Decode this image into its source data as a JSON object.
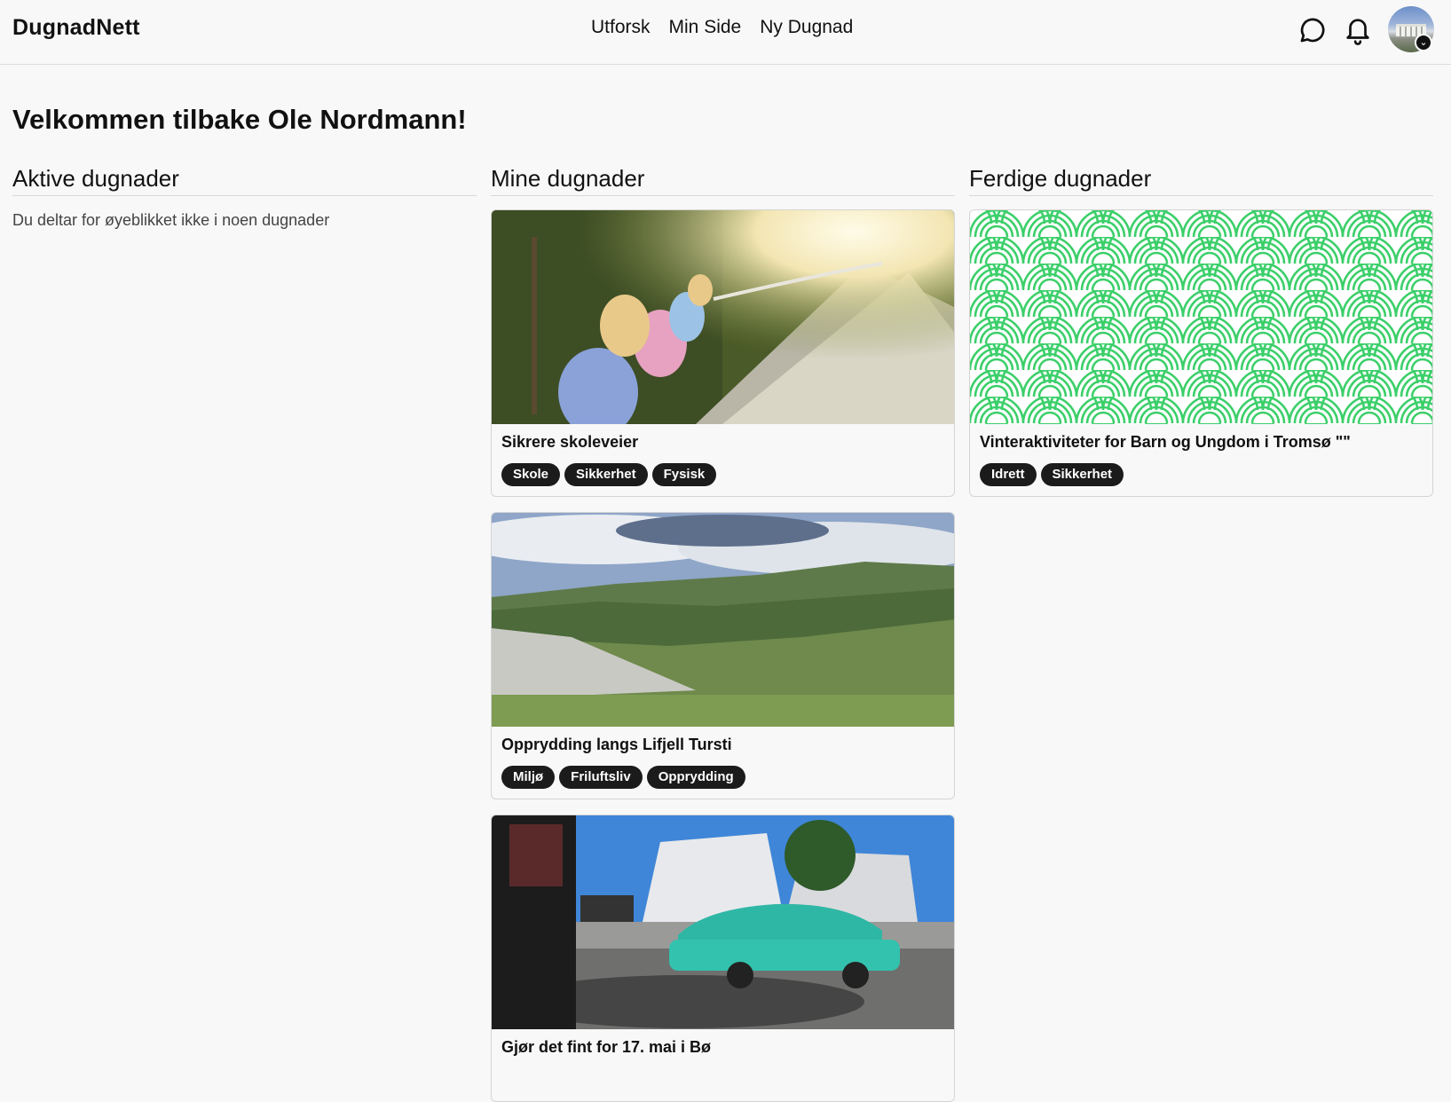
{
  "header": {
    "logo": "DugnadNett",
    "nav": [
      "Utforsk",
      "Min Side",
      "Ny Dugnad"
    ]
  },
  "welcome": "Velkommen tilbake Ole Nordmann!",
  "columns": {
    "active": {
      "title": "Aktive dugnader",
      "empty_message": "Du deltar for øyeblikket ikke i noen dugnader"
    },
    "mine": {
      "title": "Mine dugnader",
      "cards": [
        {
          "title": "Sikrere skoleveier",
          "tags": [
            "Skole",
            "Sikkerhet",
            "Fysisk"
          ]
        },
        {
          "title": "Opprydding langs Lifjell Tursti",
          "tags": [
            "Miljø",
            "Friluftsliv",
            "Opprydding"
          ]
        },
        {
          "title": "Gjør det fint for 17. mai i Bø",
          "tags": []
        }
      ]
    },
    "done": {
      "title": "Ferdige dugnader",
      "cards": [
        {
          "title": "Vinteraktiviteter for Barn og Ungdom i Tromsø \"\"",
          "tags": [
            "Idrett",
            "Sikkerhet"
          ]
        }
      ]
    }
  },
  "colors": {
    "tag_bg": "#1b1b1b",
    "pattern_green": "#3ccf6a"
  },
  "icons": [
    "chat-icon",
    "bell-icon",
    "avatar"
  ]
}
